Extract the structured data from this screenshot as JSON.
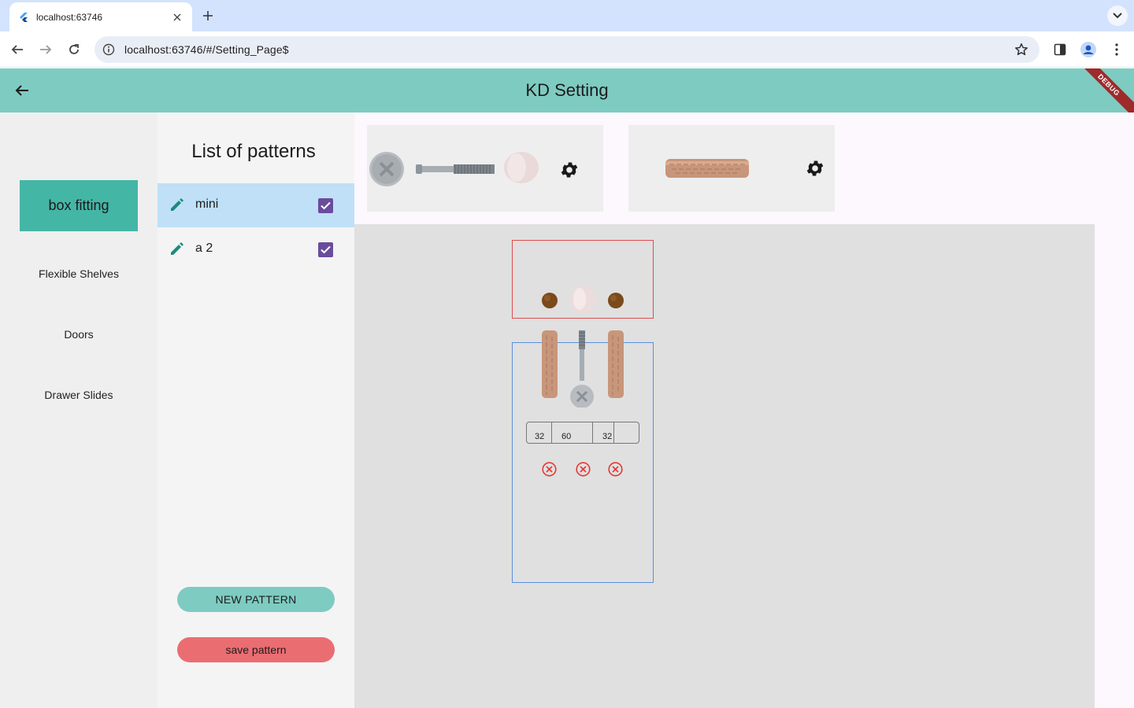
{
  "browser": {
    "tab_title": "localhost:63746",
    "url": "localhost:63746/#/Setting_Page$"
  },
  "appbar": {
    "title": "KD Setting",
    "debug_label": "DEBUG",
    "color": "#7ecbc2"
  },
  "nav": {
    "items": [
      {
        "label": "box fitting",
        "active": true
      },
      {
        "label": "Flexible Shelves",
        "active": false
      },
      {
        "label": "Doors",
        "active": false
      },
      {
        "label": "Drawer Slides",
        "active": false
      }
    ],
    "active_color": "#44b6a6"
  },
  "patterns": {
    "heading": "List of patterns",
    "items": [
      {
        "name": "mini",
        "checked": true,
        "selected": true
      },
      {
        "name": "a 2",
        "checked": true,
        "selected": false
      }
    ],
    "new_button": "NEW PATTERN",
    "save_button": "save pattern"
  },
  "fittings": {
    "cards": [
      {
        "icons": [
          "cam-screw-icon",
          "connector-bolt-icon",
          "cam-cap-icon",
          "gear-icon"
        ]
      },
      {
        "icons": [
          "wood-dowel-icon",
          "gear-icon"
        ]
      }
    ]
  },
  "editor": {
    "spacing_fields": [
      "32",
      "60",
      "",
      "32",
      ""
    ],
    "remove_buttons": 3,
    "frame_colors": {
      "top": "#e24b4b",
      "bottom": "#5b8ede"
    }
  }
}
